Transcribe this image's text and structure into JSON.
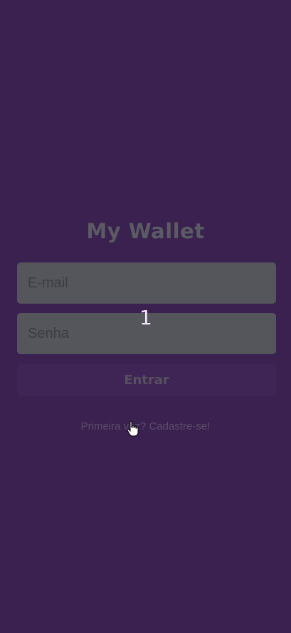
{
  "app": {
    "title": "My Wallet"
  },
  "form": {
    "email_placeholder": "E-mail",
    "password_placeholder": "Senha",
    "submit_label": "Entrar"
  },
  "signup_link": "Primeira vez? Cadastre-se!",
  "overlay": {
    "label": "1"
  },
  "icons": {
    "cursor": "hand-pointer-icon"
  },
  "colors": {
    "background": "#3a2150",
    "input": "#55555c",
    "button": "#3f2556"
  }
}
